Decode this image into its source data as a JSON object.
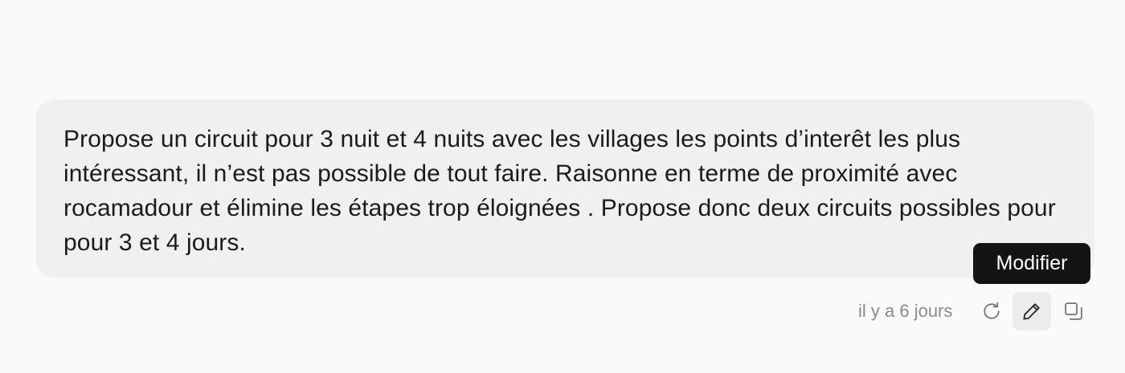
{
  "message": {
    "text": "Propose un circuit pour 3 nuit et 4 nuits avec les villages les points d’interêt les plus intéressant, il n’est pas possible de tout faire. Raisonne en terme de proximité avec rocamadour et élimine les étapes trop éloignées .  Propose donc deux circuits possibles pour pour 3 et 4 jours."
  },
  "tooltip": {
    "label": "Modifier"
  },
  "actions": {
    "timestamp": "il y a 6 jours",
    "icons": [
      "regenerate-icon",
      "pencil-icon",
      "copy-icon"
    ]
  }
}
